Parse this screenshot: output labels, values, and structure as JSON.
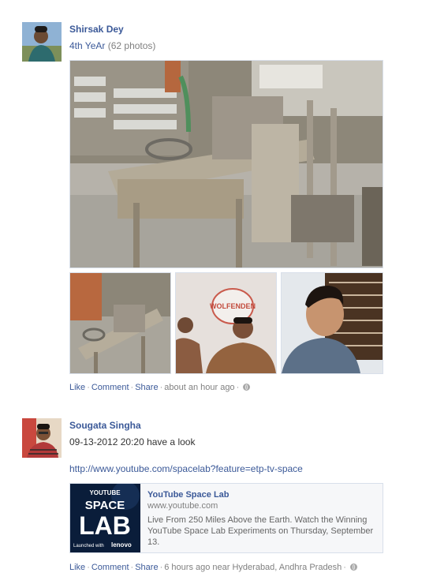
{
  "posts": [
    {
      "author": "Shirsak Dey",
      "album_title": "4th YeAr",
      "photo_count": "(62 photos)",
      "actions": {
        "like": "Like",
        "comment": "Comment",
        "share": "Share",
        "time": "about an hour ago"
      }
    },
    {
      "author": "Sougata Singha",
      "message": "09-13-2012 20:20 have a look",
      "link_url": "http://www.youtube.com/spacelab?feature=etp-tv-space",
      "attachment": {
        "title": "YouTube Space Lab",
        "domain": "www.youtube.com",
        "description": "Live From 250 Miles Above the Earth. Watch the Winning YouTube Space Lab Experiments on Thursday, September 13.",
        "thumb_lines": [
          "YOUTUBE",
          "SPACE",
          "LAB",
          "Launched with",
          "lenovo"
        ]
      },
      "actions": {
        "like": "Like",
        "comment": "Comment",
        "share": "Share",
        "time": "6 hours ago near Hyderabad, Andhra Pradesh"
      }
    }
  ],
  "photo_wall_text": "WOLFENDEN",
  "colors": {
    "link": "#3b5998",
    "muted": "#808080",
    "border": "#d8dfea"
  }
}
